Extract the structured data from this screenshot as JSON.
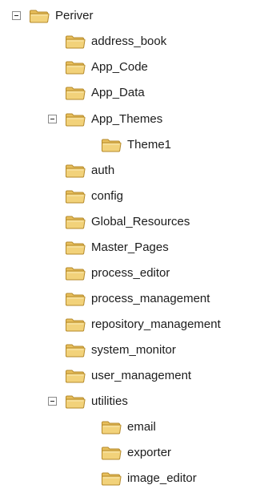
{
  "tree": {
    "root": {
      "label": "Periver",
      "expanded": true
    },
    "items": [
      {
        "label": "address_book"
      },
      {
        "label": "App_Code"
      },
      {
        "label": "App_Data"
      },
      {
        "label": "App_Themes",
        "expanded": true,
        "children": [
          {
            "label": "Theme1"
          }
        ]
      },
      {
        "label": "auth"
      },
      {
        "label": "config"
      },
      {
        "label": "Global_Resources"
      },
      {
        "label": "Master_Pages"
      },
      {
        "label": "process_editor"
      },
      {
        "label": "process_management"
      },
      {
        "label": "repository_management"
      },
      {
        "label": "system_monitor"
      },
      {
        "label": "user_management"
      },
      {
        "label": "utilities",
        "expanded": true,
        "children": [
          {
            "label": "email"
          },
          {
            "label": "exporter"
          },
          {
            "label": "image_editor"
          }
        ]
      }
    ]
  },
  "icons": {
    "folder": "folder-icon",
    "collapse": "collapse-toggle-icon"
  },
  "colors": {
    "folder_fill": "#f2d27a",
    "folder_tab": "#e8bf5c",
    "folder_edge": "#b58a2a",
    "toggle_border": "#8a8a8a"
  }
}
